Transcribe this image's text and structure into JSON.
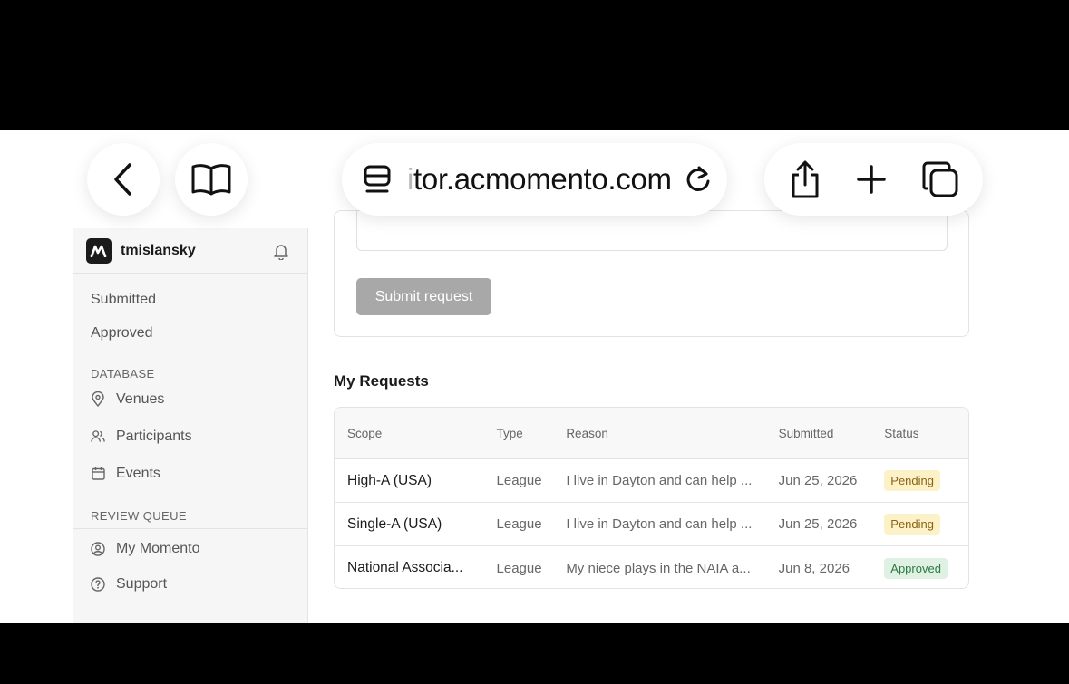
{
  "browser": {
    "url_faded": "i",
    "url_text": "tor.acmomento.com"
  },
  "sidebar": {
    "username": "tmislansky",
    "top_items": [
      "Submitted",
      "Approved"
    ],
    "database_label": "DATABASE",
    "database_items": [
      {
        "label": "Venues",
        "icon": "map-pin-icon"
      },
      {
        "label": "Participants",
        "icon": "users-icon"
      },
      {
        "label": "Events",
        "icon": "calendar-icon"
      }
    ],
    "review_label": "REVIEW QUEUE",
    "bottom_items": [
      {
        "label": "My Momento",
        "icon": "user-circle-icon"
      },
      {
        "label": "Support",
        "icon": "help-circle-icon"
      }
    ]
  },
  "form": {
    "submit_label": "Submit request"
  },
  "requests": {
    "title": "My Requests",
    "columns": [
      "Scope",
      "Type",
      "Reason",
      "Submitted",
      "Status"
    ],
    "rows": [
      {
        "scope": "High-A (USA)",
        "type": "League",
        "reason": "I live in Dayton and can help ...",
        "submitted": "Jun 25, 2026",
        "status": "Pending"
      },
      {
        "scope": "Single-A (USA)",
        "type": "League",
        "reason": "I live in Dayton and can help ...",
        "submitted": "Jun 25, 2026",
        "status": "Pending"
      },
      {
        "scope": "National Associa...",
        "type": "League",
        "reason": "My niece plays in the NAIA a...",
        "submitted": "Jun 8, 2026",
        "status": "Approved"
      }
    ]
  },
  "colors": {
    "pending_bg": "#fdf1c8",
    "approved_bg": "#dff1e3",
    "button_disabled": "#a8a8a8"
  }
}
